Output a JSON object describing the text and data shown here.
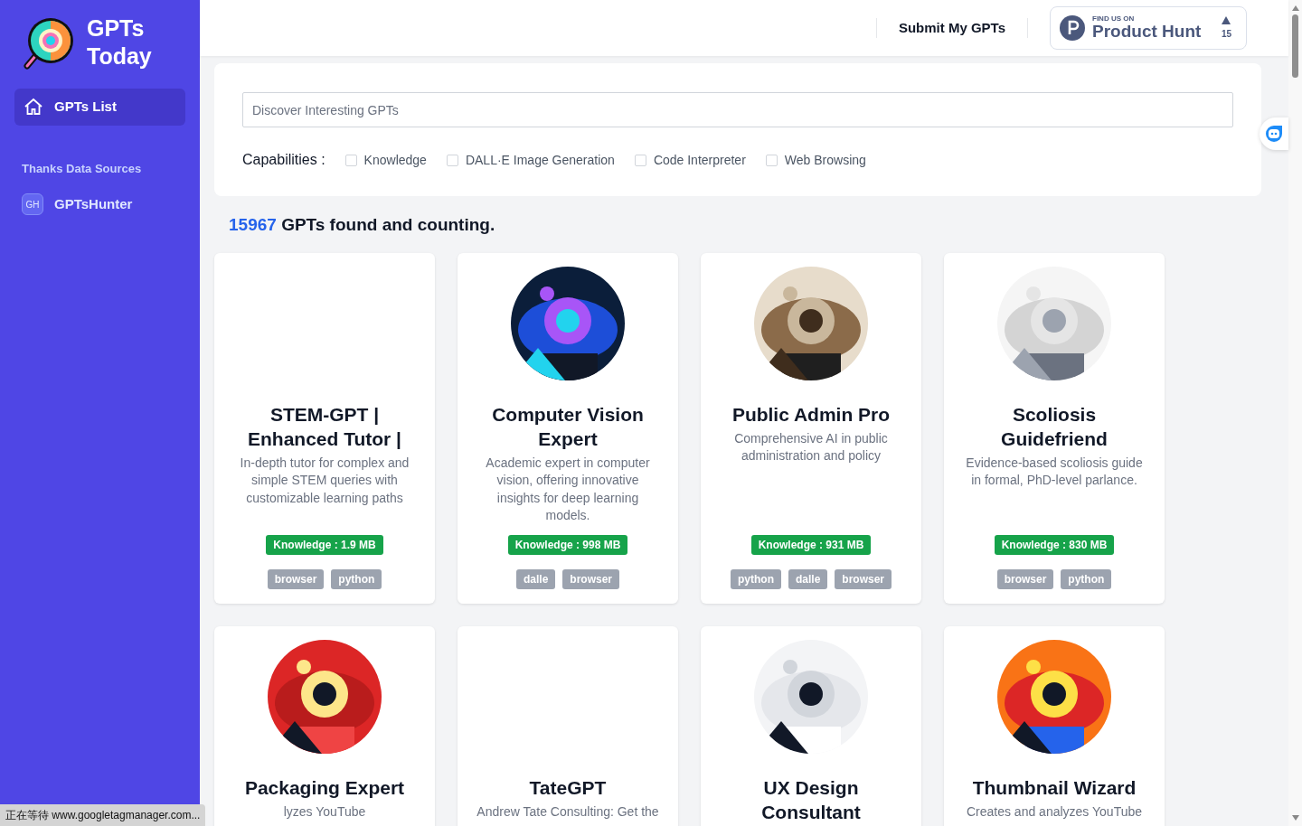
{
  "sidebar": {
    "brand": [
      "GPTs",
      "Today"
    ],
    "nav": [
      {
        "label": "GPTs List",
        "selected": true
      }
    ],
    "section_title": "Thanks Data Sources",
    "sources": [
      {
        "badge": "GH",
        "label": "GPTsHunter"
      }
    ]
  },
  "header": {
    "submit_link": "Submit My GPTs",
    "product_hunt": {
      "caption": "FIND US ON",
      "name": "Product Hunt",
      "votes": "15"
    }
  },
  "search": {
    "placeholder": "Discover Interesting GPTs"
  },
  "capabilities": {
    "label": "Capabilities :",
    "options": [
      {
        "label": "Knowledge",
        "checked": false
      },
      {
        "label": "DALL·E Image Generation",
        "checked": false
      },
      {
        "label": "Code Interpreter",
        "checked": false
      },
      {
        "label": "Web Browsing",
        "checked": false
      }
    ]
  },
  "result_count": {
    "number": "15967",
    "text": "GPTs found and counting."
  },
  "cards": [
    {
      "picture": false,
      "title": "STEM-GPT | Enhanced Tutor |",
      "description": "In-depth tutor for complex and simple STEM queries with customizable learning paths",
      "knowledge": "Knowledge : 1.9 MB",
      "tags": [
        "browser",
        "python"
      ]
    },
    {
      "picture": true,
      "title": "Computer Vision Expert",
      "description": "Academic expert in computer vision, offering innovative insights for deep learning models.",
      "knowledge": "Knowledge : 998 MB",
      "tags": [
        "dalle",
        "browser"
      ]
    },
    {
      "picture": true,
      "title": "Public Admin Pro",
      "description": "Comprehensive AI in public administration and policy",
      "knowledge": "Knowledge : 931 MB",
      "tags": [
        "python",
        "dalle",
        "browser"
      ]
    },
    {
      "picture": true,
      "title": "Scoliosis Guidefriend",
      "description": "Evidence-based scoliosis guide in formal, PhD-level parlance.",
      "knowledge": "Knowledge : 830 MB",
      "tags": [
        "browser",
        "python"
      ]
    },
    {
      "picture": true,
      "title": "Packaging Expert",
      "description": "lyzes YouTube"
    },
    {
      "picture": false,
      "title": "TateGPT",
      "description": "Andrew Tate Consulting: Get the"
    },
    {
      "picture": true,
      "title": "UX Design Consultant"
    },
    {
      "picture": true,
      "title": "Thumbnail Wizard",
      "description": "Creates and analyzes YouTube"
    }
  ],
  "status_bar": "正在等待 www.googletagmanager.com..."
}
